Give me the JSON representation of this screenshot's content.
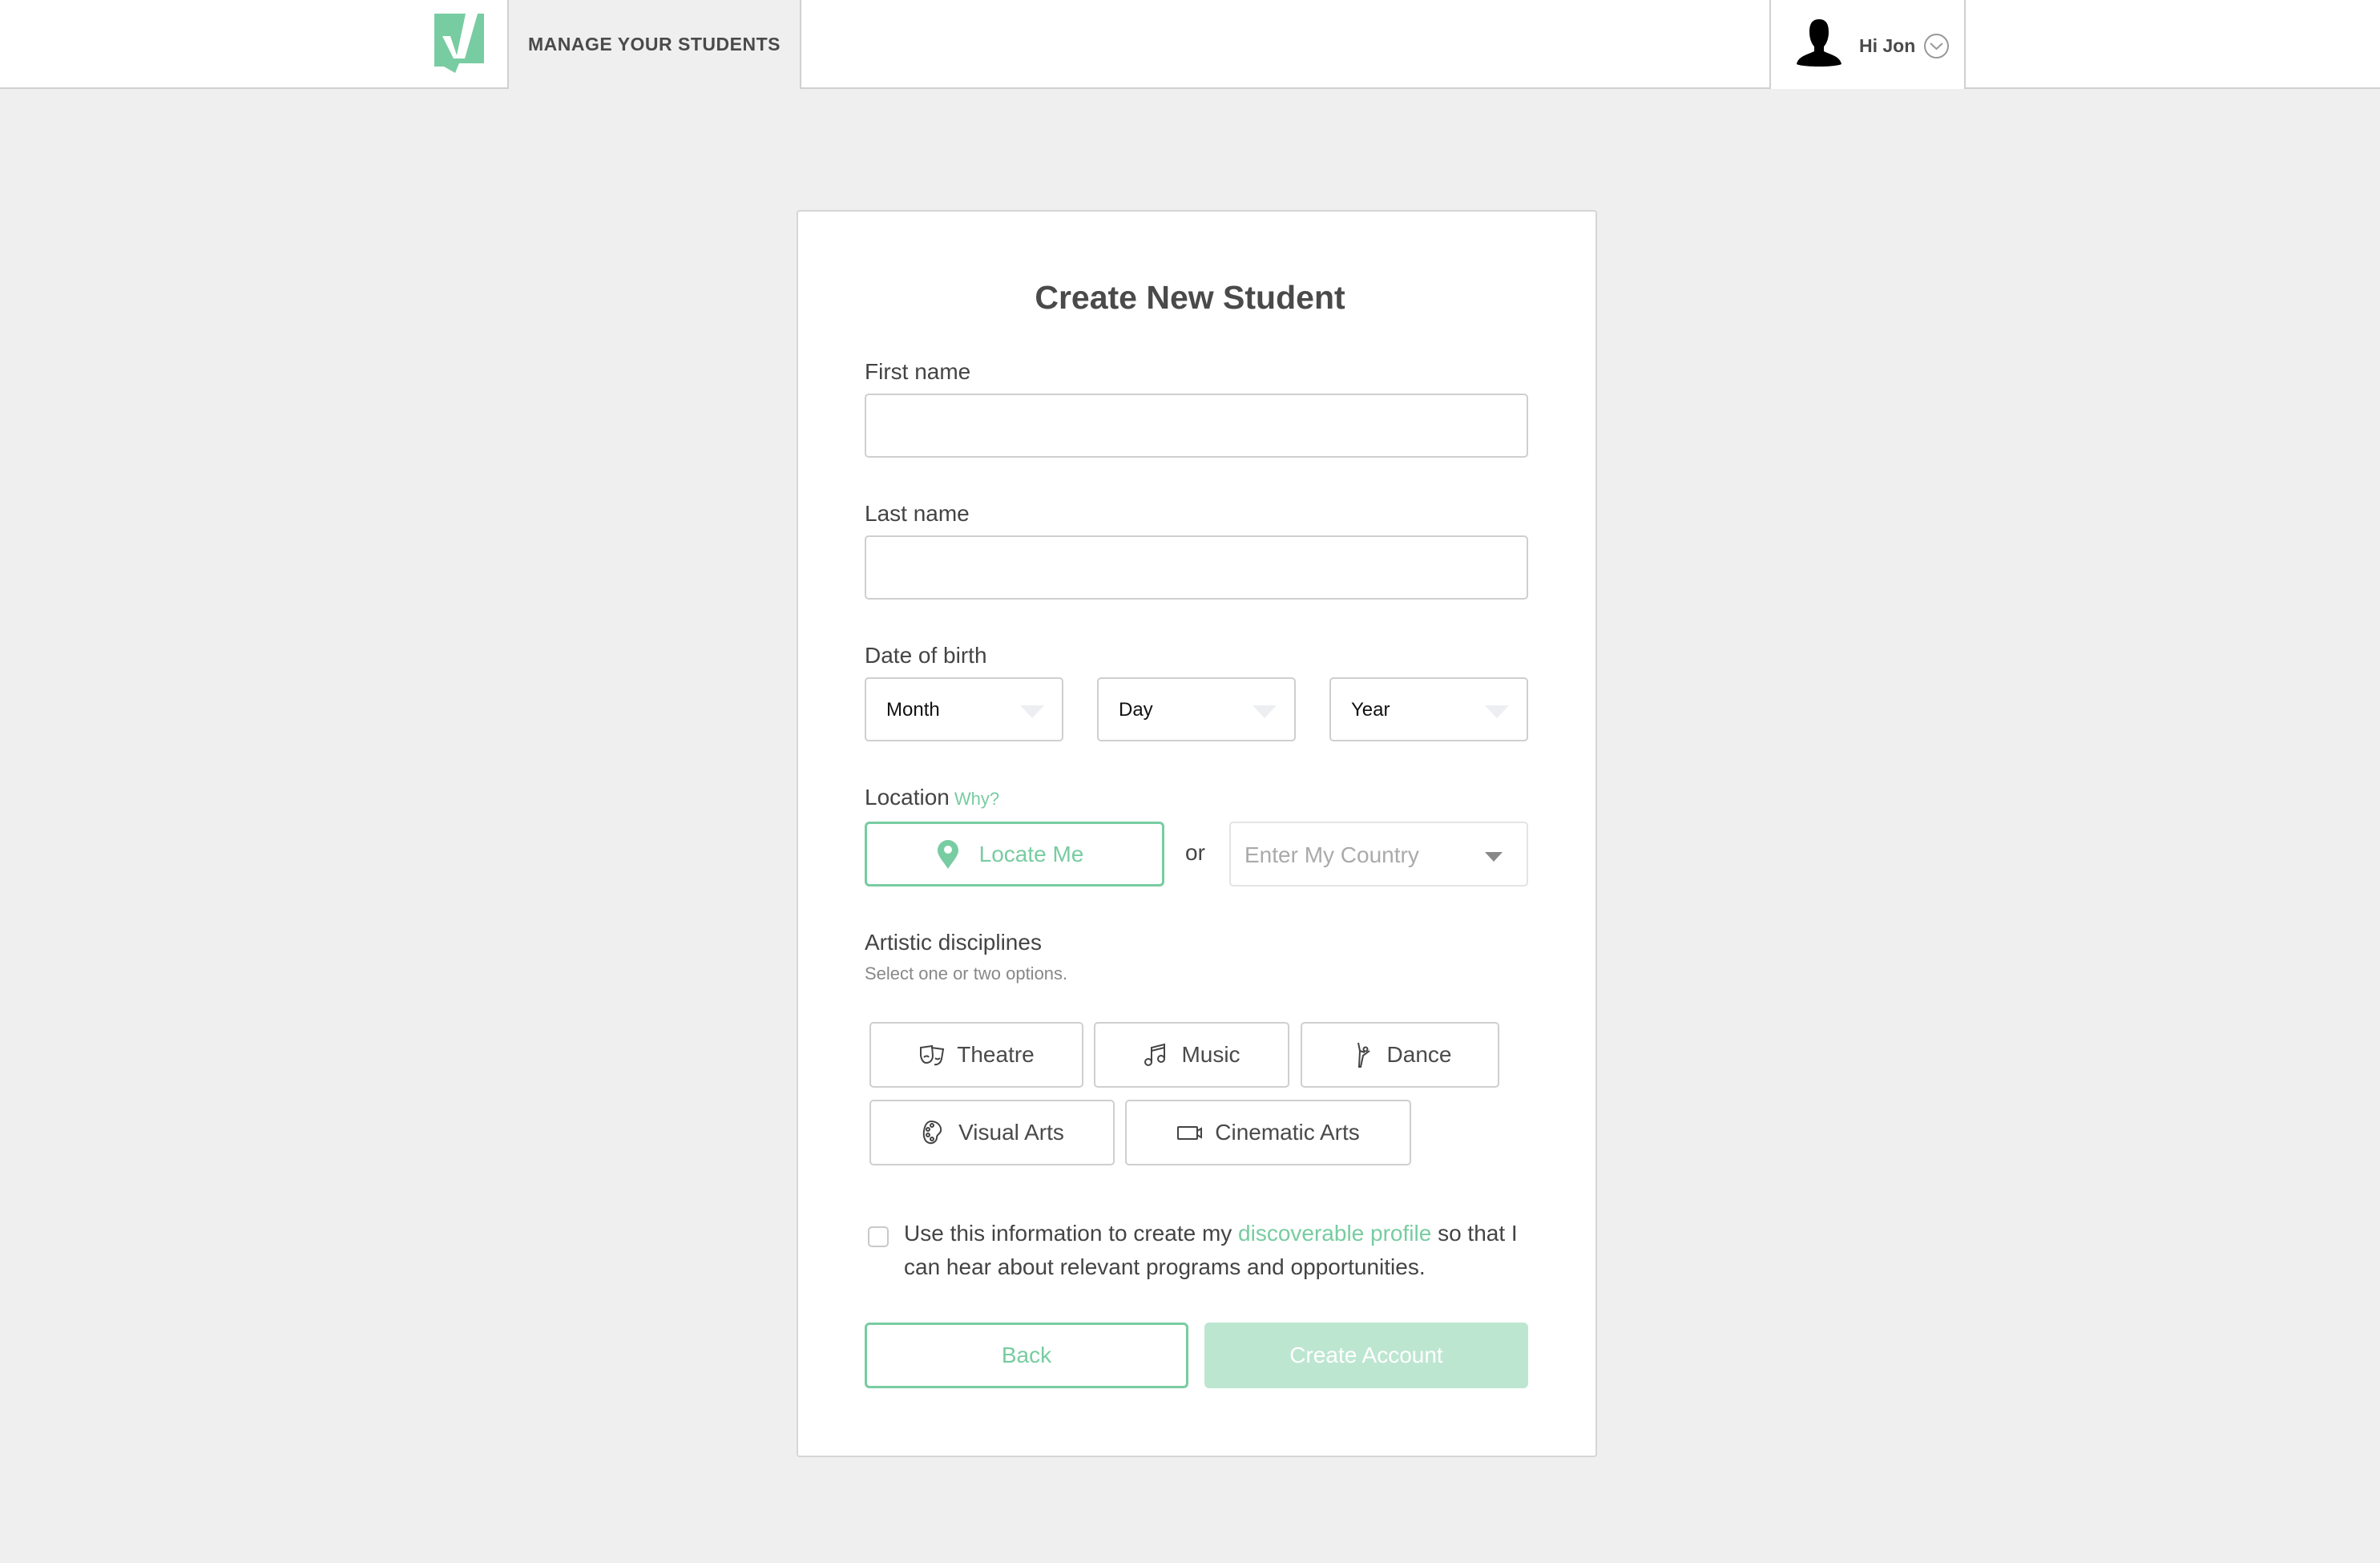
{
  "header": {
    "nav_tab": "MANAGE YOUR STUDENTS",
    "greeting": "Hi Jon",
    "brand_color": "#78cca1"
  },
  "form": {
    "title": "Create New Student",
    "first_name": {
      "label": "First name",
      "value": "",
      "placeholder": ""
    },
    "last_name": {
      "label": "Last name",
      "value": "",
      "placeholder": ""
    },
    "dob": {
      "label": "Date of birth",
      "month": "Month",
      "day": "Day",
      "year": "Year"
    },
    "location": {
      "label": "Location",
      "why_link": "Why?",
      "locate_button": "Locate Me",
      "or": "or",
      "country_placeholder": "Enter My Country"
    },
    "disciplines": {
      "label": "Artistic disciplines",
      "hint": "Select one or two options.",
      "options": [
        {
          "label": "Theatre",
          "icon": "theatre-masks-icon"
        },
        {
          "label": "Music",
          "icon": "music-note-icon"
        },
        {
          "label": "Dance",
          "icon": "dancer-icon"
        },
        {
          "label": "Visual Arts",
          "icon": "palette-icon"
        },
        {
          "label": "Cinematic Arts",
          "icon": "video-camera-icon"
        }
      ]
    },
    "consent": {
      "checked": false,
      "text_before": "Use this information to create my ",
      "link": "discoverable profile",
      "text_after": " so that I can hear about relevant programs and opportunities."
    },
    "back_button": "Back",
    "create_button": "Create Account"
  }
}
